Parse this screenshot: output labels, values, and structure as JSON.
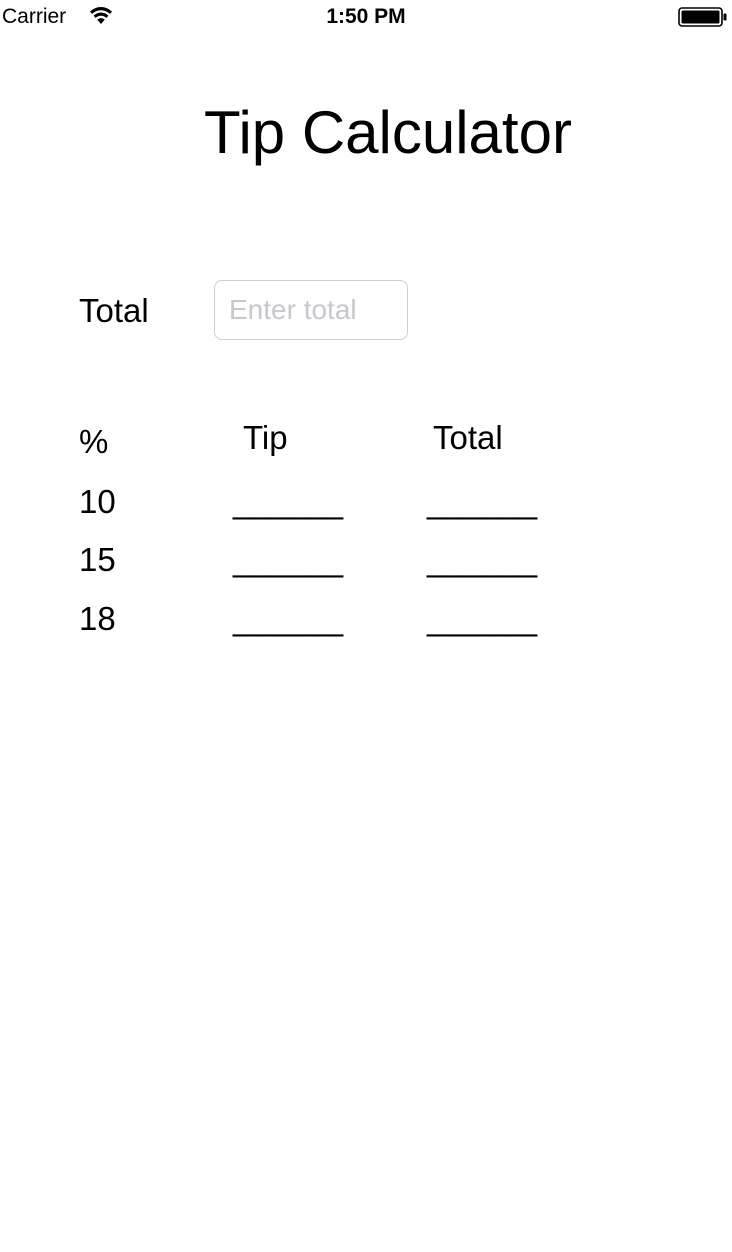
{
  "status_bar": {
    "carrier": "Carrier",
    "time": "1:50 PM",
    "wifi_icon": "wifi-icon",
    "battery_icon": "battery-icon"
  },
  "title": "Tip Calculator",
  "total_field": {
    "label": "Total",
    "placeholder": "Enter total",
    "value": ""
  },
  "table": {
    "headers": {
      "percent": "%",
      "tip": "Tip",
      "total": "Total"
    },
    "rows": [
      {
        "percent": "10",
        "tip": "______",
        "total": "______"
      },
      {
        "percent": "15",
        "tip": "______",
        "total": "______"
      },
      {
        "percent": "18",
        "tip": "______",
        "total": "______"
      }
    ]
  }
}
